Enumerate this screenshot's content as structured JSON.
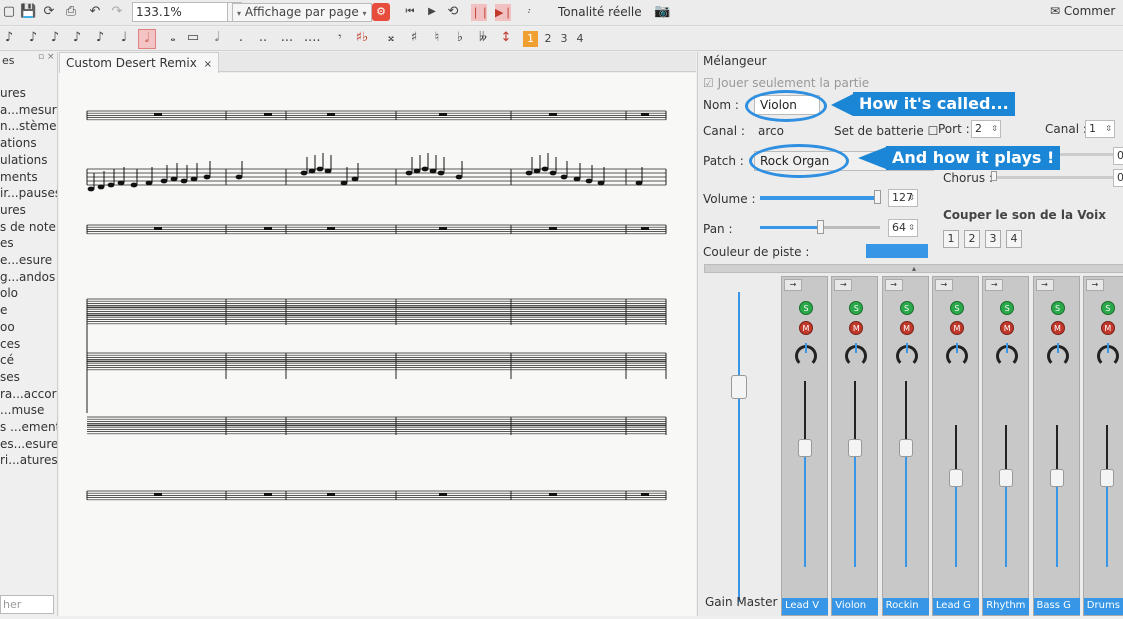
{
  "toolbar": {
    "zoom_value": "133.1%",
    "view_mode": "Affichage par page",
    "real_pitch_label": "Tonalité réelle",
    "comment_label": "Commer",
    "voice_numbers": [
      "1",
      "2",
      "3",
      "4"
    ],
    "selected_voice": "1"
  },
  "left_panel": {
    "items": [
      "ures",
      "a...mesure",
      "n...stème",
      "ations",
      "ulations",
      "ments",
      "ir...pauses",
      "ures",
      "s de note",
      "es",
      "e...esure",
      "g...andos",
      "olo",
      "e",
      "oo",
      "ces",
      "cé",
      "ses",
      "ra...accord",
      "...muse",
      "s ...ements",
      "es...esures",
      "ri...atures"
    ],
    "search_placeholder": "her"
  },
  "score": {
    "tab_label": "Custom Desert Remix"
  },
  "mixer": {
    "title": "Mélangeur",
    "solo_part_label": "Jouer seulement la partie",
    "name_label": "Nom :",
    "name_value": "Violon",
    "channel_label": "Canal :",
    "channel_value": "arco",
    "drumset_label": "Set de batterie",
    "port_label": "Port :",
    "port_value": "2",
    "canal_label": "Canal :",
    "canal_value": "1",
    "patch_label": "Patch :",
    "patch_value": "Rock Organ",
    "reverb_value": "0",
    "chorus_label": "Chorus :",
    "chorus_value": "0",
    "volume_label": "Volume :",
    "volume_value": "127",
    "pan_label": "Pan :",
    "pan_value": "64",
    "track_color_label": "Couleur de piste :",
    "track_color": "#3796e6",
    "mute_voice_label": "Couper le son de la Voix",
    "voice_buttons": [
      "1",
      "2",
      "3",
      "4"
    ],
    "gain_master_label": "Gain Master",
    "strips": [
      "Lead V",
      "Violon",
      "Rockin",
      "Lead G",
      "Rhythm",
      "Bass G",
      "Drums"
    ]
  },
  "annotations": {
    "name_callout": "How it's called...",
    "patch_callout": "And how it plays !"
  },
  "colors": {
    "accent_blue": "#1c86d6",
    "selected_voice": "#f0a030",
    "solo_green": "#2aa84a",
    "mute_red": "#c0392b"
  }
}
